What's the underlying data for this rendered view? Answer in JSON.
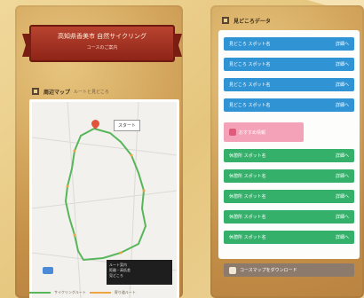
{
  "banner": {
    "title": "高知県香美市 自然サイクリング",
    "subtitle": "コースのご案内"
  },
  "left_section": {
    "label": "周辺マップ",
    "sub": "ルートと見どころ"
  },
  "map": {
    "label": "スタート",
    "legend_lines": [
      "ルート案内",
      "距離・高低差",
      "見どころ"
    ],
    "footer_green": "サイクリングルート",
    "footer_orange": "寄り道ルート",
    "route_color": "#58b65a",
    "accent_color": "#f0a440"
  },
  "right_section": {
    "label": "見どころデータ"
  },
  "rows": [
    {
      "label": "見どころ スポット名",
      "value": "詳細へ",
      "color": "blue"
    },
    {
      "label": "見どころ スポット名",
      "value": "詳細へ",
      "color": "blue"
    },
    {
      "label": "見どころ スポット名",
      "value": "詳細へ",
      "color": "blue"
    },
    {
      "label": "見どころ スポット名",
      "value": "詳細へ",
      "color": "blue"
    },
    {
      "label": "おすすめ情報",
      "value": "",
      "color": "pink"
    },
    {
      "label": "休憩所 スポット名",
      "value": "詳細へ",
      "color": "green"
    },
    {
      "label": "休憩所 スポット名",
      "value": "詳細へ",
      "color": "green"
    },
    {
      "label": "休憩所 スポット名",
      "value": "詳細へ",
      "color": "green"
    },
    {
      "label": "休憩所 スポット名",
      "value": "詳細へ",
      "color": "green"
    },
    {
      "label": "休憩所 スポット名",
      "value": "詳細へ",
      "color": "green"
    },
    {
      "label": "コースマップをダウンロード",
      "value": "",
      "color": "brown"
    }
  ]
}
